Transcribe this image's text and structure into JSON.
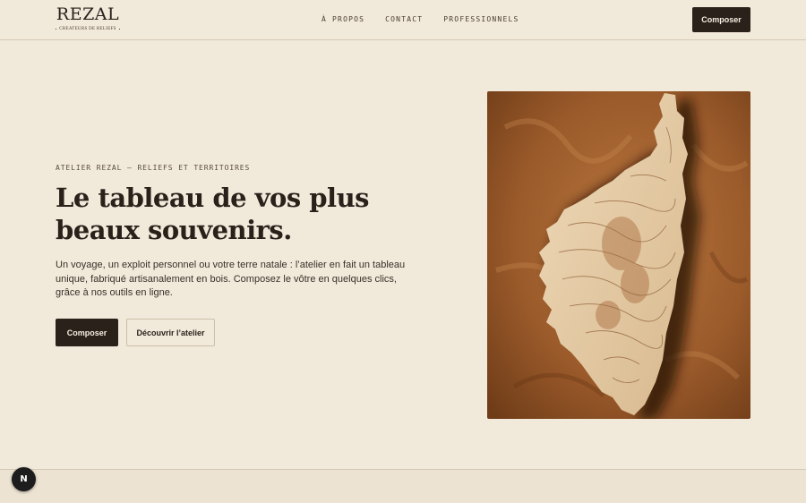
{
  "header": {
    "logo": {
      "wordmark": "REZAL",
      "tagline": "CREATEURS DE RELIEFS"
    },
    "nav": [
      {
        "label": "À PROPOS"
      },
      {
        "label": "CONTACT"
      },
      {
        "label": "PROFESSIONNELS"
      }
    ],
    "cta_label": "Composer"
  },
  "hero": {
    "eyebrow": "ATELIER REZAL — RELIEFS ET TERRITOIRES",
    "headline": "Le tableau de vos plus beaux souvenirs.",
    "lead": "Un voyage, un exploit personnel ou votre terre natale : l’atelier en fait un tableau unique, fabriqué artisanalement en bois. Composez le vôtre en quelques clics, grâce à nos outils en ligne.",
    "primary_label": "Composer",
    "secondary_label": "Découvrir l’atelier"
  },
  "dev_badge": {
    "letter": "N"
  },
  "colors": {
    "background": "#f1e9da",
    "ink": "#2a211b",
    "wood": "#e8d2b0",
    "copper": "#a9612c"
  }
}
